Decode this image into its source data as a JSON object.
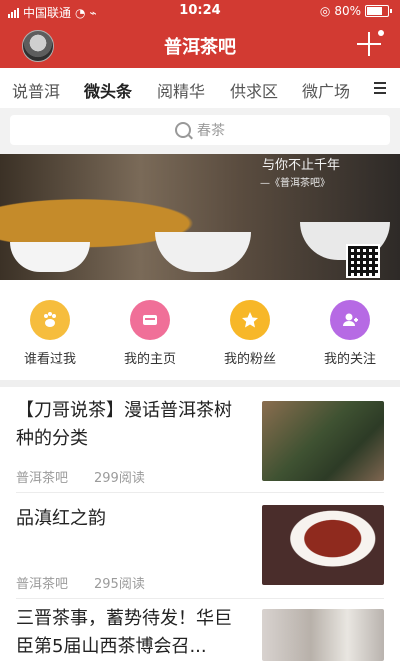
{
  "status": {
    "carrier": "中国联通",
    "time": "10:24",
    "battery": "80%"
  },
  "nav": {
    "title": "普洱茶吧"
  },
  "tabs": [
    "说普洱",
    "微头条",
    "阅精华",
    "供求区",
    "微广场"
  ],
  "search": {
    "placeholder": "春茶"
  },
  "banner": {
    "slogan": "与你不止千年",
    "slogan_sub": "—《普洱茶吧》"
  },
  "quick_links": [
    {
      "label": "谁看过我",
      "icon": "paw-icon",
      "color": "#f6bd3d"
    },
    {
      "label": "我的主页",
      "icon": "card-icon",
      "color": "#f06f98"
    },
    {
      "label": "我的粉丝",
      "icon": "star-icon",
      "color": "#f7b728"
    },
    {
      "label": "我的关注",
      "icon": "user-icon",
      "color": "#b66ae4"
    }
  ],
  "feed": [
    {
      "title": "【刀哥说茶】漫话普洱茶树种的分类",
      "source": "普洱茶吧",
      "reads": "299阅读"
    },
    {
      "title": "品滇红之韵",
      "source": "普洱茶吧",
      "reads": "295阅读"
    },
    {
      "title": "三晋茶事，蓄势待发！华巨臣第5届山西茶博会召...",
      "source": "",
      "reads": ""
    }
  ]
}
